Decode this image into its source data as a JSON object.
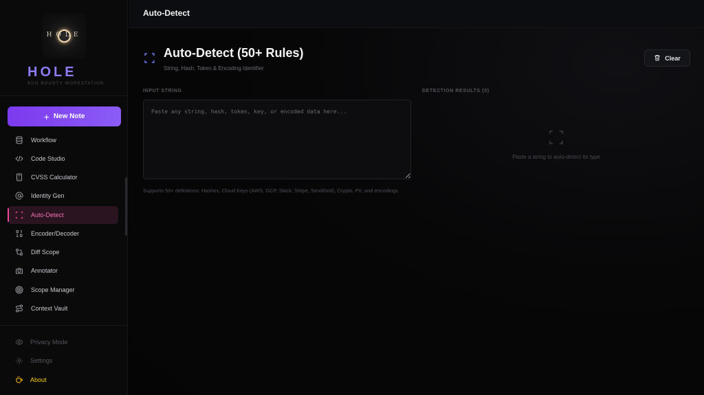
{
  "brand": {
    "logo_text": "HOLE",
    "name": "HOLE",
    "subtitle": "BUG BOUNTY WORKSTATION"
  },
  "sidebar": {
    "new_note_label": "New Note",
    "items": [
      {
        "label": "Workflow",
        "icon": "database-icon"
      },
      {
        "label": "Code Studio",
        "icon": "code-icon"
      },
      {
        "label": "CVSS Calculator",
        "icon": "calculator-icon"
      },
      {
        "label": "Identity Gen",
        "icon": "at-sign-icon"
      },
      {
        "label": "Auto-Detect",
        "icon": "scan-icon",
        "active": true
      },
      {
        "label": "Encoder/Decoder",
        "icon": "binary-icon"
      },
      {
        "label": "Diff Scope",
        "icon": "git-compare-icon"
      },
      {
        "label": "Annotator",
        "icon": "camera-icon"
      },
      {
        "label": "Scope Manager",
        "icon": "target-icon"
      },
      {
        "label": "Context Vault",
        "icon": "route-icon"
      }
    ],
    "bottom": [
      {
        "label": "Privacy Mode",
        "icon": "eye-icon"
      },
      {
        "label": "Settings",
        "icon": "gear-icon"
      },
      {
        "label": "About",
        "icon": "coffee-icon"
      }
    ]
  },
  "topbar": {
    "title": "Auto-Detect"
  },
  "header": {
    "title": "Auto-Detect (50+ Rules)",
    "subtitle": "String, Hash, Token & Encoding Identifier",
    "clear_label": "Clear"
  },
  "input": {
    "section_label": "INPUT STRING",
    "value": "",
    "placeholder": "Paste any string, hash, token, key, or encoded data here...",
    "hint": "Supports 50+ definitions: Hashes, Cloud Keys (AWS, GCP, Slack, Stripe, SendGrid), Crypto, PII, and encodings."
  },
  "results": {
    "section_label": "DETECTION RESULTS (0)",
    "empty_text": "Paste a string to auto-detect its type"
  },
  "colors": {
    "accent": "#8b5cf6",
    "active": "#ec4899",
    "brand": "#8b7cf6",
    "about": "#facc15",
    "scan": "#6d7bf5"
  }
}
